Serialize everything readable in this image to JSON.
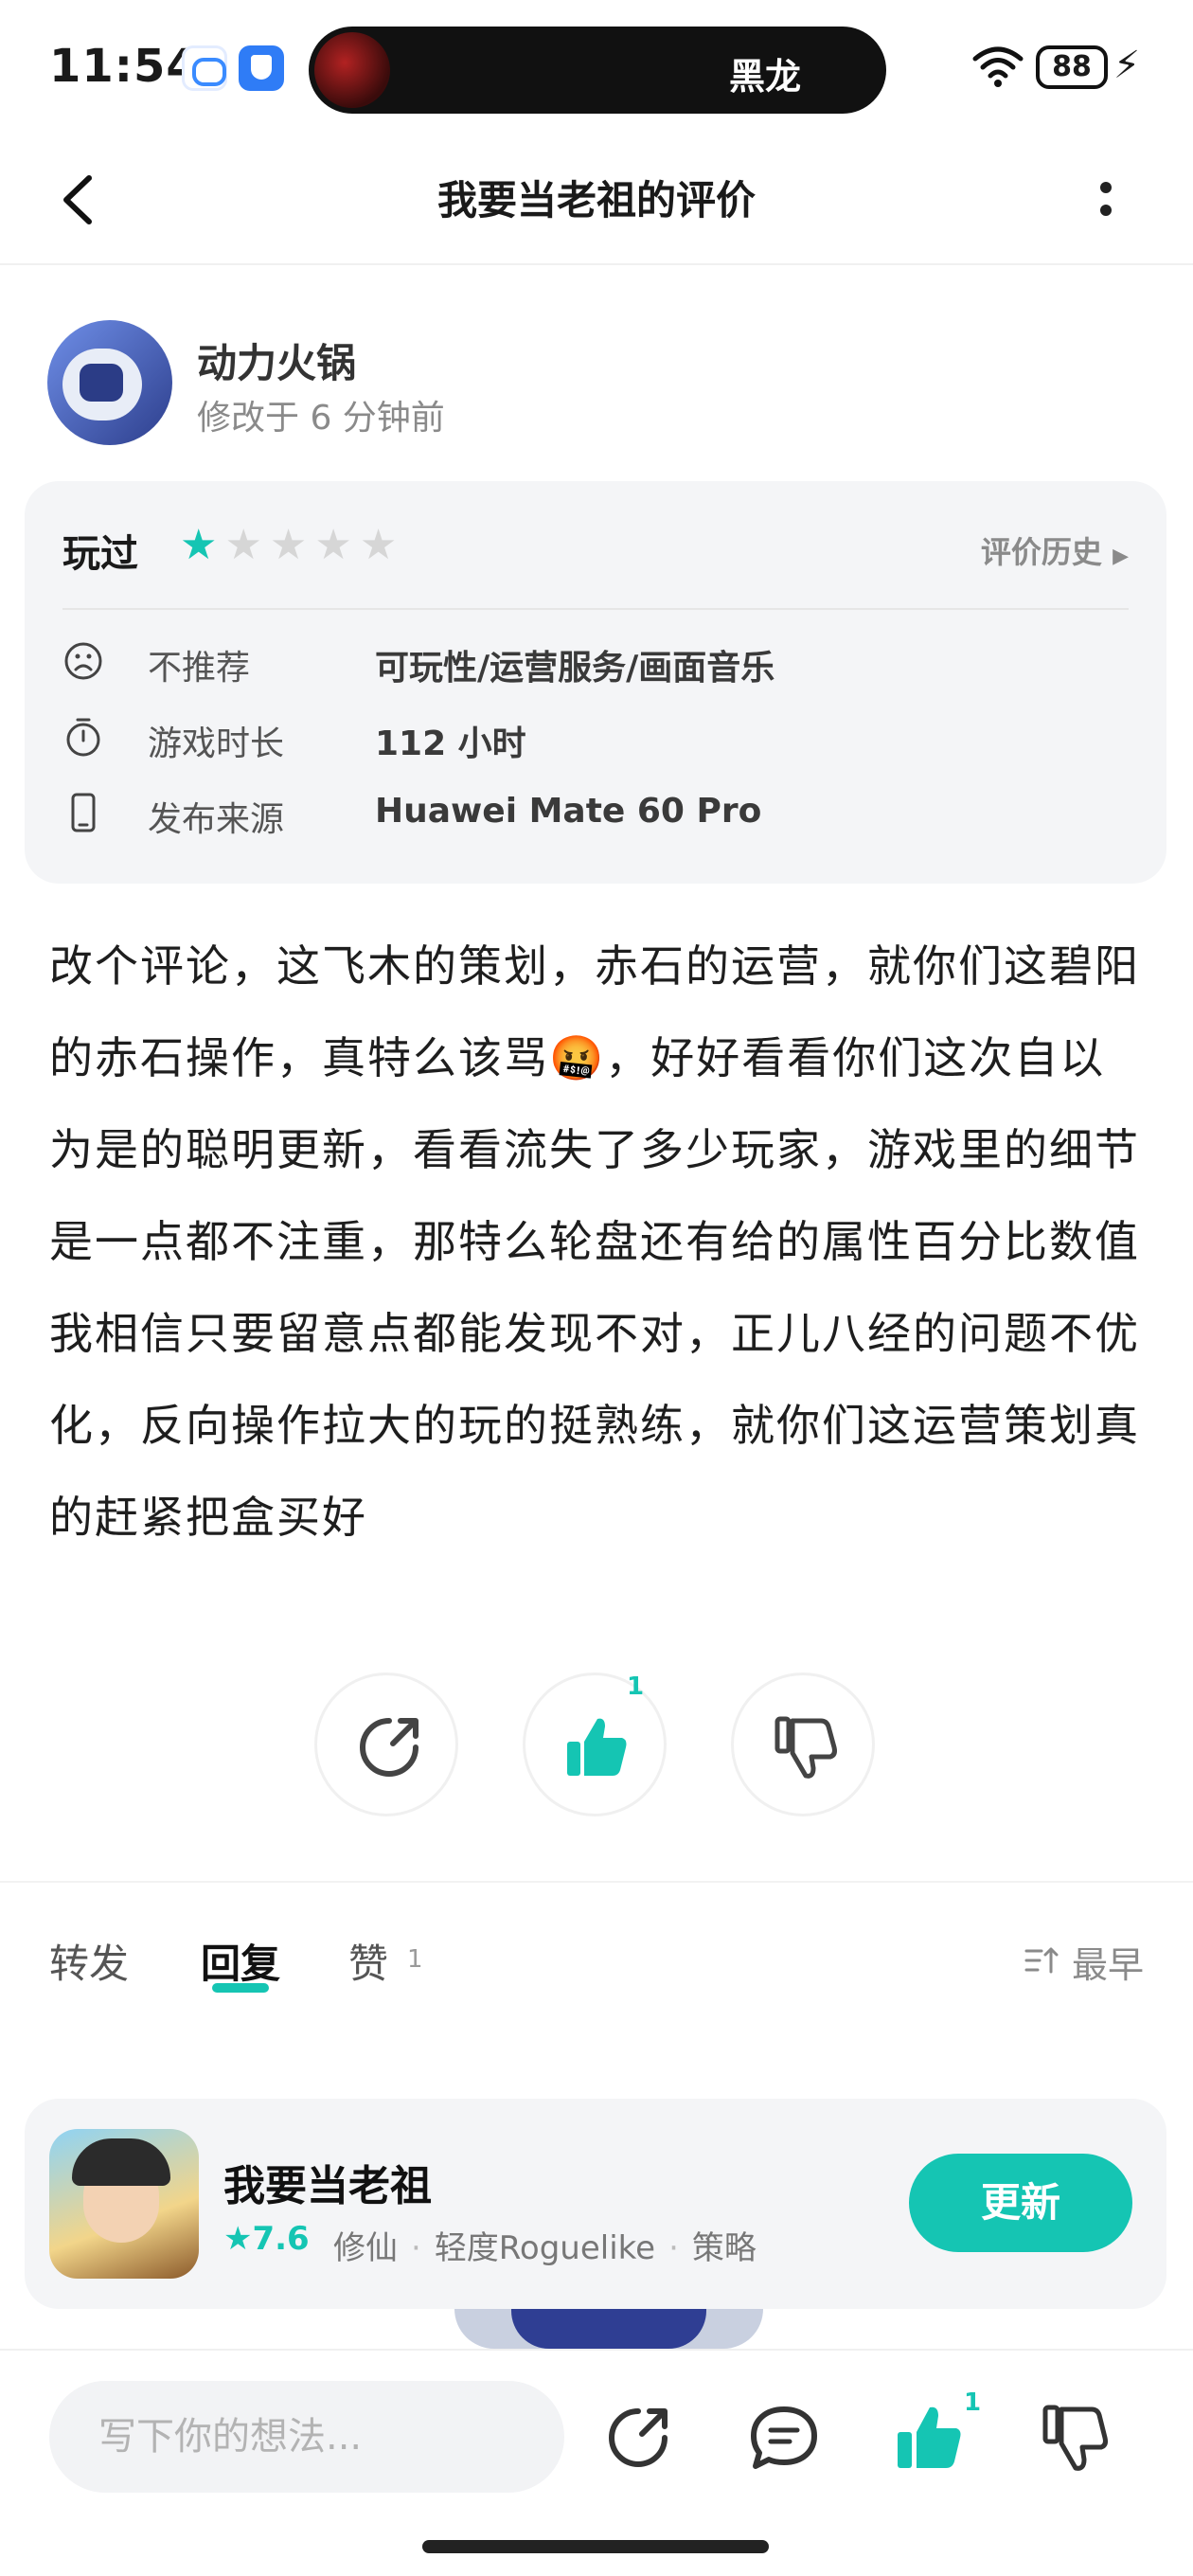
{
  "status_bar": {
    "time": "11:54",
    "island_text": "黑龙",
    "battery": "88"
  },
  "nav": {
    "title": "我要当老祖的评价"
  },
  "user": {
    "name": "动力火锅",
    "time": "修改于 6 分钟前"
  },
  "review_meta": {
    "status": "玩过",
    "rating": 1,
    "max_rating": 5,
    "history_label": "评价历史",
    "rows": [
      {
        "icon": "sad-face-icon",
        "label": "不推荐",
        "value": "可玩性/运营服务/画面音乐"
      },
      {
        "icon": "stopwatch-icon",
        "label": "游戏时长",
        "value": "112 小时"
      },
      {
        "icon": "phone-icon",
        "label": "发布来源",
        "value": "Huawei Mate 60 Pro"
      }
    ]
  },
  "review": {
    "text": "改个评论，这飞木的策划，赤石的运营，就你们这碧阳的赤石操作，真特么该骂🤬，好好看看你们这次自以为是的聪明更新，看看流失了多少玩家，游戏里的细节是一点都不注重，那特么轮盘还有给的属性百分比数值我相信只要留意点都能发现不对，正儿八经的问题不优化，反向操作拉大的玩的挺熟练，就你们这运营策划真的赶紧把盒买好"
  },
  "actions": {
    "like_count": "1"
  },
  "tabs": {
    "items": [
      {
        "label": "转发"
      },
      {
        "label": "回复"
      },
      {
        "label": "赞"
      }
    ],
    "like_badge": "1",
    "sort_label": "最早"
  },
  "game": {
    "name": "我要当老祖",
    "score": "7.6",
    "tags": [
      "修仙",
      "轻度Roguelike",
      "策略"
    ],
    "button_label": "更新"
  },
  "bottom_bar": {
    "placeholder": "写下你的想法...",
    "like_count": "1"
  },
  "colors": {
    "accent": "#15c5b3",
    "card_bg": "#f4f5f7"
  }
}
